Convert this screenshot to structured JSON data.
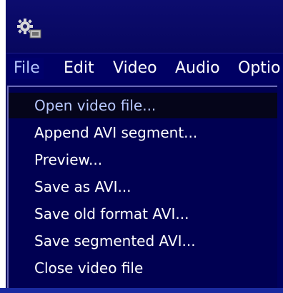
{
  "window": {
    "app_icon": "gear-chip-icon"
  },
  "menubar": {
    "items": [
      {
        "label": "File"
      },
      {
        "label": "Edit"
      },
      {
        "label": "Video"
      },
      {
        "label": "Audio"
      },
      {
        "label": "Optio"
      }
    ]
  },
  "file_menu": {
    "items": [
      {
        "label": "Open video file..."
      },
      {
        "label": "Append AVI segment..."
      },
      {
        "label": "Preview..."
      },
      {
        "label": "Save as AVI..."
      },
      {
        "label": "Save old format AVI..."
      },
      {
        "label": "Save segmented AVI..."
      },
      {
        "label": "Close video file"
      }
    ]
  },
  "colors": {
    "window_background": "#00005e",
    "menu_background": "#000052",
    "highlight_background": "#05051a",
    "highlight_text": "#b8c8ff",
    "text": "#ffffff"
  }
}
